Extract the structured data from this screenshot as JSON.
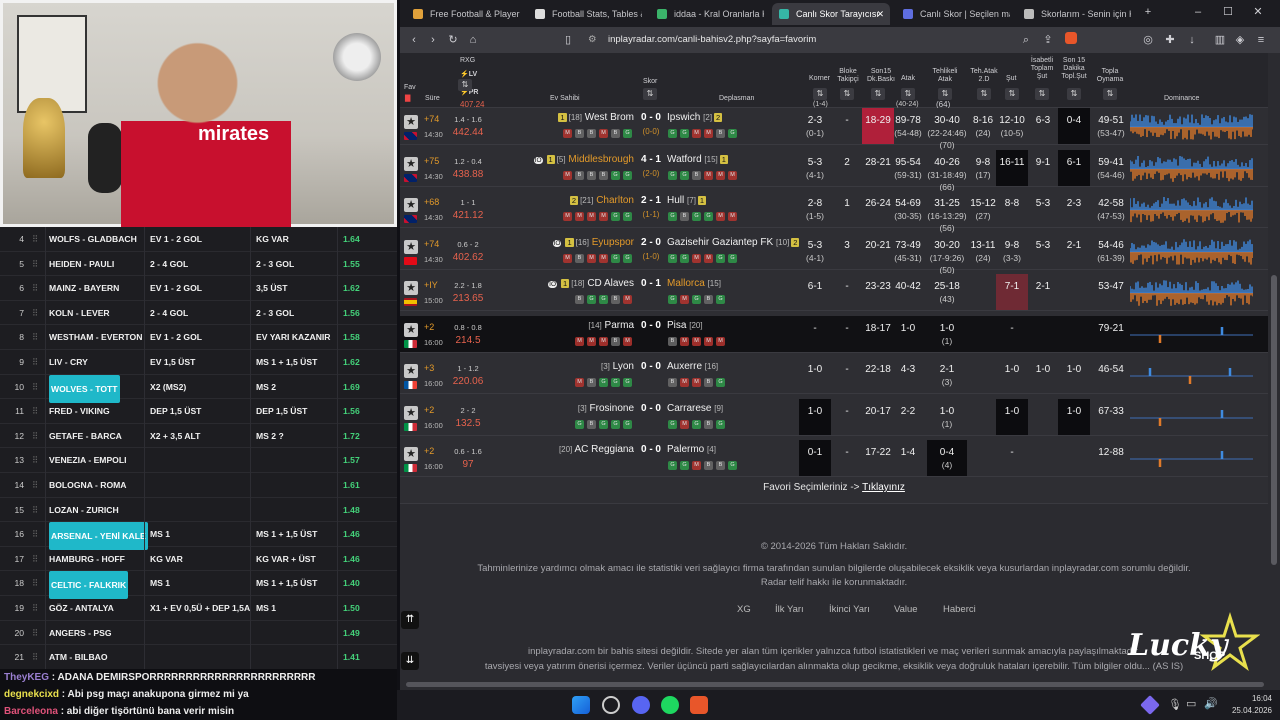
{
  "webcam": {
    "shirt_text": "mirates"
  },
  "sheet": {
    "rows": [
      {
        "no": "4",
        "match": "WOLFS - GLADBACH",
        "bet1": "EV 1 - 2 GOL",
        "bet2": "KG VAR",
        "odd": "1.64",
        "hl": false
      },
      {
        "no": "5",
        "match": "HEIDEN - PAULI",
        "bet1": "2 - 4 GOL",
        "bet2": "2 - 3 GOL",
        "odd": "1.55",
        "hl": false
      },
      {
        "no": "6",
        "match": "MAINZ - BAYERN",
        "bet1": "EV 1 - 2 GOL",
        "bet2": "3,5 ÜST",
        "odd": "1.62",
        "hl": false
      },
      {
        "no": "7",
        "match": "KOLN - LEVER",
        "bet1": "2 - 4 GOL",
        "bet2": "2 - 3 GOL",
        "odd": "1.56",
        "hl": false
      },
      {
        "no": "8",
        "match": "WESTHAM - EVERTON",
        "bet1": "EV 1 - 2 GOL",
        "bet2": "EV YARI KAZANIR",
        "odd": "1.58",
        "hl": false
      },
      {
        "no": "9",
        "match": "LIV - CRY",
        "bet1": "EV 1,5 ÜST",
        "bet2": "MS 1 + 1,5 ÜST",
        "odd": "1.62",
        "hl": false
      },
      {
        "no": "10",
        "match": "WOLVES - TOTT",
        "bet1": "X2 (MS2)",
        "bet2": "MS 2",
        "odd": "1.69",
        "hl": true
      },
      {
        "no": "11",
        "match": "FRED - VIKING",
        "bet1": "DEP 1,5 ÜST",
        "bet2": "DEP 1,5 ÜST",
        "odd": "1.56",
        "hl": false
      },
      {
        "no": "12",
        "match": "GETAFE - BARCA",
        "bet1": "X2 + 3,5 ALT",
        "bet2": "MS 2 ?",
        "odd": "1.72",
        "hl": false
      },
      {
        "no": "13",
        "match": "VENEZIA - EMPOLI",
        "bet1": "",
        "bet2": "",
        "odd": "1.57",
        "hl": false
      },
      {
        "no": "14",
        "match": "BOLOGNA - ROMA",
        "bet1": "",
        "bet2": "",
        "odd": "1.61",
        "hl": false
      },
      {
        "no": "15",
        "match": "LOZAN - ZURICH",
        "bet1": "",
        "bet2": "",
        "odd": "1.48",
        "hl": false
      },
      {
        "no": "16",
        "match": "ARSENAL - YENİ KALE",
        "bet1": "MS 1",
        "bet2": "MS 1 + 1,5 ÜST",
        "odd": "1.46",
        "hl": true
      },
      {
        "no": "17",
        "match": "HAMBURG - HOFF",
        "bet1": "KG VAR",
        "bet2": "KG VAR + ÜST",
        "odd": "1.46",
        "hl": false
      },
      {
        "no": "18",
        "match": "CELTIC - FALKRIK",
        "bet1": "MS 1",
        "bet2": "MS 1 + 1,5 ÜST",
        "odd": "1.40",
        "hl": true
      },
      {
        "no": "19",
        "match": "GÖZ - ANTALYA",
        "bet1": "X1 + EV 0,5Ü + DEP 1,5A",
        "bet2": "MS 1",
        "odd": "1.50",
        "hl": false
      },
      {
        "no": "20",
        "match": "ANGERS - PSG",
        "bet1": "",
        "bet2": "",
        "odd": "1.49",
        "hl": false
      },
      {
        "no": "21",
        "match": "ATM - BILBAO",
        "bet1": "",
        "bet2": "",
        "odd": "1.41",
        "hl": false
      }
    ]
  },
  "chat": {
    "lines": [
      {
        "user": "TheyKEG",
        "msg": " : ADANA DEMIRSPORRRRRRRRRRRRRRRRRRRRRRR",
        "color": "#9a7fd1"
      },
      {
        "user": "degnekcixd",
        "msg": " : Abi psg maçı anakupona girmez mi ya",
        "color": "#e9e04d"
      },
      {
        "user": "Barceleona",
        "msg": " : abi diğer tişörtünü bana verir misin",
        "color": "#e0527a"
      }
    ]
  },
  "browser": {
    "tabs": [
      {
        "label": "Free Football & Player St",
        "color": "#e0a13b",
        "active": false
      },
      {
        "label": "Football Stats, Tables & R",
        "color": "#dddddd",
        "active": false
      },
      {
        "label": "iddaa - Kral Oranlarla Kra",
        "color": "#3bb36a",
        "active": false
      },
      {
        "label": "Canlı Skor Tarayıcısı",
        "color": "#36b6a6",
        "active": true
      },
      {
        "label": "Canlı Skor | Seçilen maçl",
        "color": "#5f6ee0",
        "active": false
      },
      {
        "label": "Skorlarım - Senin için Kişi",
        "color": "#bbbbbb",
        "active": false
      }
    ],
    "url": "inplayradar.com/canli-bahisv2.php?sayfa=favorim"
  },
  "table": {
    "headers": {
      "fav": "Fav",
      "sure": "Süre",
      "rxg": "RXG",
      "lv": "LV",
      "pr": "PR",
      "skor": "Skor",
      "ev": "Ev Sahibi",
      "dep": "Deplasman",
      "korner": "Korner",
      "blok": "Bloke Takipçi",
      "son15": "Son15 Dk.Baskı",
      "atak": "Atak",
      "tehatak": "Tehlikeli Atak",
      "teh2d": "Teh.Atak 2.D",
      "sut": "Şut",
      "isabet": "İsabetli Toplam Şut",
      "son15sut": "Son 15 Dakika Topl.Şut",
      "topla": "Topla Oynama",
      "dom": "Dominance"
    },
    "partial": {
      "xg": "407.24",
      "teh": "(64)",
      "korner": "(1-4)",
      "atak": "(40-24)"
    },
    "matches": [
      {
        "min": "74",
        "flag": "gb",
        "time": "14:30",
        "rx": "1.4 - 1.6",
        "rxg": "442.44",
        "home": "West Brom",
        "hrank": "[18]",
        "hico": "1",
        "score": "0 - 0",
        "ht": "(0-0)",
        "away": "Ipswich",
        "arank": "[2]",
        "aico": "2",
        "hforms": "MBBMBG",
        "aforms": "GGMMBG",
        "korner": "2-3",
        "korner2": "(0-1)",
        "blok": "-",
        "son15": "18-29",
        "atak": "89-78",
        "atak2": "(54-48)",
        "teh": "30-40",
        "teh2": "(22-24:46)",
        "teh3": "(70)",
        "teh2d": "8-16",
        "teh2d2": "(24)",
        "sut": "12-10",
        "sut2": "(10-5)",
        "isabet": "6-3",
        "son15sut": "0-4",
        "topla": "49-51",
        "topla2": "(53-47)",
        "dark": false,
        "dom": "full"
      },
      {
        "min": "75",
        "flag": "gb",
        "time": "14:30",
        "rx": "1.2 - 0.4",
        "rxg": "438.88",
        "home": "Middlesbrough",
        "hrank": "[5]",
        "hico": "1",
        "score": "4 - 1",
        "ht": "(2-0)",
        "away": "Watford",
        "arank": "[15]",
        "aico": "1",
        "hforms": "MBBBGG",
        "aforms": "GGBMMM",
        "korner": "5-3",
        "korner2": "(4-1)",
        "blok": "2",
        "son15": "28-21",
        "atak": "95-54",
        "atak2": "(59-31)",
        "teh": "40-26",
        "teh2": "(31-18:49)",
        "teh3": "(66)",
        "teh2d": "9-8",
        "teh2d2": "(17)",
        "sut": "16-11",
        "sut2": "",
        "isabet": "9-1",
        "son15sut": "6-1",
        "topla": "59-41",
        "topla2": "(54-46)",
        "dark": false,
        "dom": "full"
      },
      {
        "min": "68",
        "flag": "gb",
        "time": "14:30",
        "rx": "1 - 1",
        "rxg": "421.12",
        "home": "Charlton",
        "hrank": "[21]",
        "hico": "2",
        "score": "2 - 1",
        "ht": "(1-1)",
        "away": "Hull",
        "arank": "[7]",
        "aico": "1",
        "hforms": "MMMMGG",
        "aforms": "GBGGMM",
        "korner": "2-8",
        "korner2": "(1-5)",
        "blok": "1",
        "son15": "26-24",
        "atak": "54-69",
        "atak2": "(30-35)",
        "teh": "31-25",
        "teh2": "(16-13:29)",
        "teh3": "(56)",
        "teh2d": "15-12",
        "teh2d2": "(27)",
        "sut": "8-8",
        "sut2": "",
        "isabet": "5-3",
        "son15sut": "2-3",
        "topla": "42-58",
        "topla2": "(47-53)",
        "dark": false,
        "dom": "full"
      },
      {
        "min": "74",
        "flag": "tr",
        "time": "14:30",
        "rx": "0.6 - 2",
        "rxg": "402.62",
        "home": "Eyupspor",
        "hrank": "[16]",
        "hico": "1",
        "score": "2 - 0",
        "ht": "(1-0)",
        "away": "Gazisehir Gaziantep FK",
        "arank": "[10]",
        "aico": "2",
        "hforms": "MBMMGG",
        "aforms": "GGMMGG",
        "korner": "5-3",
        "korner2": "(4-1)",
        "blok": "3",
        "son15": "20-21",
        "atak": "73-49",
        "atak2": "(45-31)",
        "teh": "30-20",
        "teh2": "(17-9:26)",
        "teh3": "(50)",
        "teh2d": "13-11",
        "teh2d2": "(24)",
        "sut": "9-8",
        "sut2": "(3-3)",
        "isabet": "5-3",
        "son15sut": "2-1",
        "topla": "54-46",
        "topla2": "(61-39)",
        "dark": false,
        "dom": "full"
      },
      {
        "min": "IY",
        "flag": "es",
        "time": "15:00",
        "rx": "2.2 - 1.8",
        "rxg": "213.65",
        "home": "CD Alaves",
        "hrank": "[18]",
        "hico": "1",
        "score": "0 - 1",
        "ht": "",
        "away": "Mallorca",
        "arank": "[15]",
        "aico": "",
        "hforms": "BGGBM",
        "aforms": "GMGBG",
        "korner": "6-1",
        "korner2": "",
        "blok": "-",
        "son15": "23-23",
        "atak": "40-42",
        "atak2": "",
        "teh": "25-18",
        "teh2": "(43)",
        "teh3": "",
        "teh2d": "",
        "teh2d2": "",
        "sut": "7-1",
        "sut2": "",
        "isabet": "2-1",
        "son15sut": "",
        "topla": "53-47",
        "topla2": "",
        "dark": false,
        "dom": "full"
      },
      {
        "min": "2",
        "flag": "it",
        "time": "16:00",
        "rx": "0.8 - 0.8",
        "rxg": "214.5",
        "home": "Parma",
        "hrank": "[14]",
        "hico": "",
        "score": "0 - 0",
        "ht": "",
        "away": "Pisa",
        "arank": "[20]",
        "aico": "",
        "hforms": "MMMBM",
        "aforms": "BMMMM",
        "korner": "-",
        "korner2": "",
        "blok": "-",
        "son15": "18-17",
        "atak": "1-0",
        "atak2": "",
        "teh": "1-0",
        "teh2": "(1)",
        "teh3": "",
        "teh2d": "",
        "teh2d2": "",
        "sut": "-",
        "sut2": "",
        "isabet": "",
        "son15sut": "",
        "topla": "79-21",
        "topla2": "",
        "dark": true,
        "dom": "sparse"
      },
      {
        "min": "3",
        "flag": "fr",
        "time": "16:00",
        "rx": "1 - 1.2",
        "rxg": "220.06",
        "home": "Lyon",
        "hrank": "[3]",
        "hico": "",
        "score": "0 - 0",
        "ht": "",
        "away": "Auxerre",
        "arank": "[16]",
        "aico": "",
        "hforms": "MBGGG",
        "aforms": "BMMBG",
        "korner": "1-0",
        "korner2": "",
        "blok": "-",
        "son15": "22-18",
        "atak": "4-3",
        "atak2": "",
        "teh": "2-1",
        "teh2": "(3)",
        "teh3": "",
        "teh2d": "",
        "teh2d2": "",
        "sut": "1-0",
        "sut2": "",
        "isabet": "1-0",
        "son15sut": "1-0",
        "topla": "46-54",
        "topla2": "",
        "dark": false,
        "dom": "sparse"
      },
      {
        "min": "2",
        "flag": "it",
        "time": "16:00",
        "rx": "2 - 2",
        "rxg": "132.5",
        "home": "Frosinone",
        "hrank": "[3]",
        "hico": "",
        "score": "0 - 0",
        "ht": "",
        "away": "Carrarese",
        "arank": "[9]",
        "aico": "",
        "hforms": "GBGGG",
        "aforms": "GMGBG",
        "korner": "1-0",
        "korner2": "",
        "blok": "-",
        "son15": "20-17",
        "atak": "2-2",
        "atak2": "",
        "teh": "1-0",
        "teh2": "(1)",
        "teh3": "",
        "teh2d": "",
        "teh2d2": "",
        "sut": "1-0",
        "sut2": "",
        "isabet": "",
        "son15sut": "1-0",
        "topla": "67-33",
        "topla2": "",
        "dark": false,
        "dom": "sparse"
      },
      {
        "min": "2",
        "flag": "it",
        "time": "16:00",
        "rx": "0.6 - 1.6",
        "rxg": "97",
        "home": "AC Reggiana",
        "hrank": "[20]",
        "hico": "",
        "score": "0 - 0",
        "ht": "",
        "away": "Palermo",
        "arank": "[4]",
        "aico": "",
        "hforms": "",
        "aforms": "GGMBBG",
        "korner": "0-1",
        "korner2": "",
        "blok": "-",
        "son15": "17-22",
        "atak": "1-4",
        "atak2": "",
        "teh": "0-4",
        "teh2": "(4)",
        "teh3": "",
        "teh2d": "",
        "teh2d2": "",
        "sut": "-",
        "sut2": "",
        "isabet": "",
        "son15sut": "",
        "topla": "12-88",
        "topla2": "",
        "dark": false,
        "dom": "sparse"
      }
    ]
  },
  "fav_link": {
    "text": "Favori Seçimleriniz -> ",
    "link": "Tıklayınız"
  },
  "footer": {
    "copyright": "© 2014-2026 Tüm Hakları Saklıdır.",
    "disclaimer1": "Tahminlerinize yardımcı olmak amacı ile statistiki veri sağlayıcı firma tarafından sunulan bilgilerde oluşabilecek eksiklik veya kusurlardan inplayradar.com sorumlu değildir.",
    "disclaimer2": "Radar telif hakkı ile korunmaktadır.",
    "links": [
      "XG",
      "İlk Yarı",
      "İkinci Yarı",
      "Value",
      "Haberci"
    ],
    "note1": "inplayradar.com bir bahis sitesi değildir. Sitede yer alan tüm içerikler yalnızca futbol istatistikleri ve maç verileri sunmak amacıyla paylaşılmaktadır.",
    "note2": "tavsiyesi veya yatırım önerisi içermez. Veriler üçüncü parti sağlayıcılardan alınmakta olup gecikme, eksiklik veya doğruluk hataları içerebilir. Tüm bilgiler oldu... (AS IS)"
  },
  "logo": {
    "line1": "Lucky",
    "line2": "SHOP"
  },
  "taskbar": {
    "time": "16:04",
    "date": "25.04.2026"
  }
}
